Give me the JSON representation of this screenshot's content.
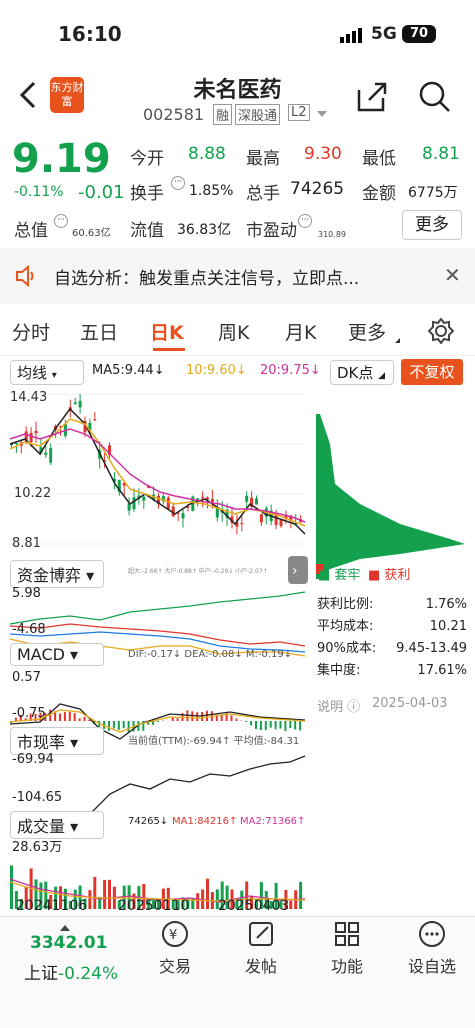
{
  "status": {
    "time": "16:10",
    "network": "5G",
    "battery": "70"
  },
  "header": {
    "name": "未名医药",
    "code": "002581",
    "tags": [
      "融",
      "深股通",
      "L2"
    ],
    "logo": "东方财富"
  },
  "quote": {
    "price": "9.19",
    "pct": "-0.11%",
    "chg": "-0.01",
    "open_label": "今开",
    "open": "8.88",
    "high_label": "最高",
    "high": "9.30",
    "low_label": "最低",
    "low": "8.81",
    "turnover_label": "换手",
    "turnover": "1.85%",
    "vol_label": "总手",
    "vol": "74265",
    "amount_label": "金额",
    "amount": "6775万",
    "mktcap_label": "总值",
    "mktcap": "60.63亿",
    "float_label": "流值",
    "float": "36.83亿",
    "pe_label": "市盈动",
    "pe": "310.89",
    "more": "更多"
  },
  "alert": {
    "text": "自选分析：触发重点关注信号，立即点..."
  },
  "tabs": [
    "分时",
    "五日",
    "日K",
    "周K",
    "月K",
    "更多"
  ],
  "chart": {
    "ma_btn": "均线",
    "ma5": "MA5:9.44↓",
    "ma10": "10:9.60↓",
    "ma20": "20:9.75↓",
    "dk_btn": "DK点",
    "fq_btn": "不复权",
    "price_top": "14.43",
    "price_mid": "10.22",
    "price_low": "8.81",
    "fund_label": "资金博弈",
    "fund_top": "5.98",
    "fund_low": "-4.68",
    "fund_note": "超大:-2.66↑ 大户:0.88↑ 中户:-0.29↓ 小户:2.07↑",
    "macd_label": "MACD",
    "macd_note": "DIF:-0.17↓ DEA:-0.08↓ M:-0.19↓",
    "macd_top": "0.57",
    "macd_low": "-0.75",
    "pe_label": "市现率",
    "pe_note": "当前值(TTM):-69.94↑ 平均值:-84.31",
    "pe_top": "-69.94",
    "pe_low": "-104.65",
    "vol_label": "成交量",
    "vol_note": "74265↓",
    "vol_ma1": "MA1:84216↑",
    "vol_ma2": "MA2:71366↑",
    "vol_top": "28.63万",
    "dates": [
      "20241106",
      "20250110",
      "20250403"
    ]
  },
  "chip": {
    "legend_trap": "套牢",
    "legend_profit": "获利",
    "rows": [
      [
        "获利比例:",
        "1.76%"
      ],
      [
        "平均成本:",
        "10.21"
      ],
      [
        "90%成本:",
        "9.45-13.49"
      ],
      [
        "集中度:",
        "17.61%"
      ]
    ],
    "note": "说明",
    "date": "2025-04-03"
  },
  "bottom": {
    "index_val": "3342.01",
    "index_name": "上证",
    "index_pct": "-0.24%",
    "items": [
      "交易",
      "发帖",
      "功能",
      "设自选"
    ]
  },
  "colors": {
    "up": "#e0352b",
    "down": "#13a14e",
    "accent": "#e8531d"
  }
}
